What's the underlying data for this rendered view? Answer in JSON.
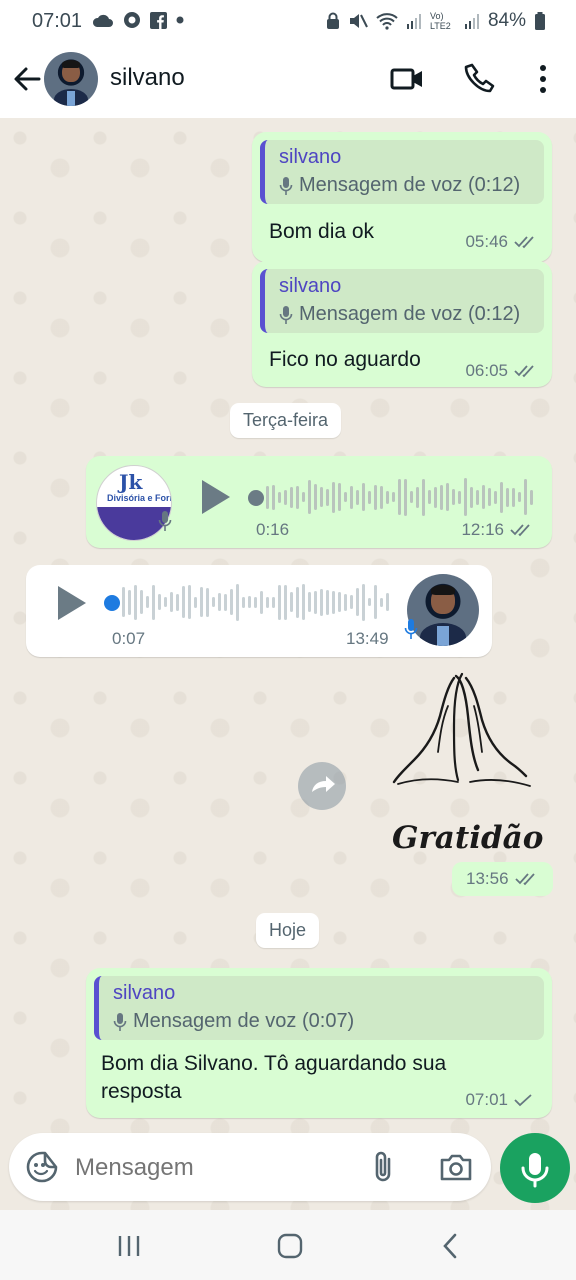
{
  "status_bar": {
    "time": "07:01",
    "network_label": "Vo) LTE2",
    "battery": "84%"
  },
  "header": {
    "contact_name": "silvano"
  },
  "messages": [
    {
      "direction": "outgoing",
      "quote_author": "silvano",
      "quote_text": "Mensagem de voz (0:12)",
      "text": "Bom dia ok",
      "time": "05:46",
      "status": "read"
    },
    {
      "direction": "outgoing",
      "quote_author": "silvano",
      "quote_text": "Mensagem de voz (0:12)",
      "text": "Fico no aguardo",
      "time": "06:05",
      "status": "read"
    },
    {
      "type": "date",
      "label": "Terça-feira"
    },
    {
      "direction": "outgoing",
      "type": "voice",
      "duration": "0:16",
      "time": "12:16",
      "status": "read",
      "thumb_logo": "Jk",
      "thumb_subtitle": "Divisória e Forro",
      "progress": 0
    },
    {
      "direction": "incoming",
      "type": "voice",
      "duration": "0:07",
      "time": "13:49",
      "progress": 0
    },
    {
      "direction": "outgoing",
      "type": "sticker",
      "sticker_text": "Gratidão",
      "time": "13:56",
      "status": "read"
    },
    {
      "type": "date",
      "label": "Hoje"
    },
    {
      "direction": "outgoing",
      "quote_author": "silvano",
      "quote_text": "Mensagem de voz (0:07)",
      "text": "Bom dia Silvano. Tô aguardando sua resposta",
      "time": "07:01",
      "status": "sent"
    }
  ],
  "composer": {
    "placeholder": "Mensagem"
  },
  "colors": {
    "outgoing_bubble": "#d9fdd3",
    "incoming_bubble": "#ffffff",
    "chat_background": "#efeae2",
    "accent_green": "#1aa260",
    "quote_bar": "#5a50d1",
    "unplayed_dot": "#1e7be0"
  },
  "icons": {
    "back": "arrow-left-icon",
    "video": "video-camera-icon",
    "call": "phone-icon",
    "menu": "more-vert-icon",
    "quote_mic": "mic-icon",
    "forward": "forward-icon",
    "emoji": "sticker-smile-icon",
    "attach": "paperclip-icon",
    "camera": "camera-icon",
    "record": "mic-icon"
  }
}
